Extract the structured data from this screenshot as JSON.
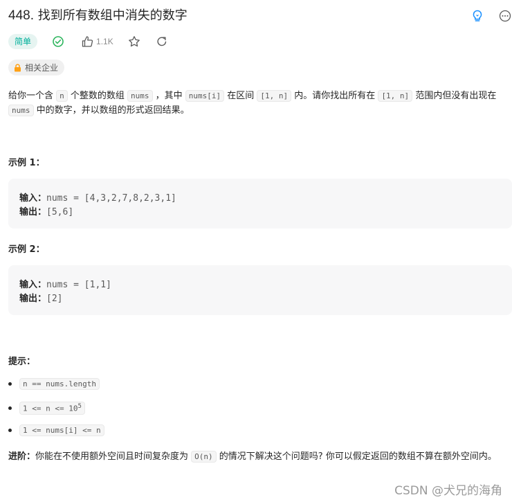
{
  "problem": {
    "number": "448.",
    "title": "找到所有数组中消失的数字",
    "difficulty": "简单",
    "likes": "1.1K",
    "companies_label": "相关企业"
  },
  "icons": {
    "hint": "lightbulb-icon",
    "more": "more-icon",
    "solved": "check-circle-icon",
    "like": "thumbs-up-icon",
    "star": "star-icon",
    "share": "share-icon",
    "lock": "lock-icon"
  },
  "colors": {
    "easy_text": "#00af9b",
    "easy_bg": "#e6f4f1",
    "hint_icon": "#1a90ff",
    "lock_icon": "#ffa116"
  },
  "description": {
    "p1_a": "给你一个含 ",
    "code_n": "n",
    "p1_b": " 个整数的数组 ",
    "code_nums": "nums",
    "p1_c": " ，其中 ",
    "code_numsi": "nums[i]",
    "p1_d": " 在区间 ",
    "code_range": "[1, n]",
    "p1_e": " 内。请你找出所有在 ",
    "code_range2": "[1, n]",
    "p1_f": " 范围内但没有出现在 ",
    "code_nums2": "nums",
    "p1_g": " 中的数字，并以数组的形式返回结果。"
  },
  "examples": [
    {
      "title": "示例 1：",
      "input_label": "输入：",
      "input": "nums = [4,3,2,7,8,2,3,1]",
      "output_label": "输出：",
      "output": "[5,6]"
    },
    {
      "title": "示例 2：",
      "input_label": "输入：",
      "input": "nums = [1,1]",
      "output_label": "输出：",
      "output": "[2]"
    }
  ],
  "hints": {
    "title": "提示：",
    "items": [
      "n == nums.length",
      "1 <= n <= 10",
      "1 <= nums[i] <= n"
    ],
    "sup": "5"
  },
  "followup": {
    "label": "进阶：",
    "text_a": "你能在不使用额外空间且时间复杂度为 ",
    "code": "O(n)",
    "text_b": " 的情况下解决这个问题吗? 你可以假定返回的数组不算在额外空间内。"
  },
  "watermark": "CSDN @犬兄的海角"
}
